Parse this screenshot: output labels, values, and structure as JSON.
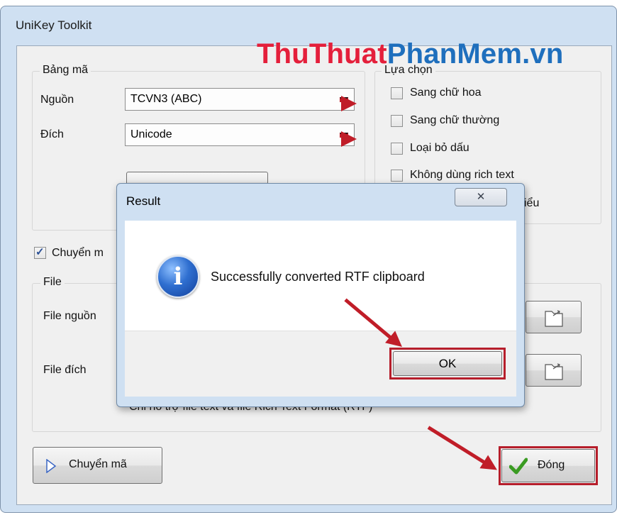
{
  "window": {
    "title": "UniKey Toolkit"
  },
  "watermark": {
    "part1": "ThuThuat",
    "part2": "PhanMem.vn"
  },
  "bang_ma": {
    "legend": "Bảng mã",
    "source_label": "Nguồn",
    "source_value": "TCVN3 (ABC)",
    "dest_label": "Đích",
    "dest_value": "Unicode"
  },
  "options": {
    "legend": "Lựa chọn",
    "items": [
      {
        "label": "Sang chữ hoa",
        "checked": false
      },
      {
        "label": "Sang chữ thường",
        "checked": false
      },
      {
        "label": "Loại bỏ dấu",
        "checked": false
      },
      {
        "label": "Không dùng rich text",
        "checked": false
      },
      {
        "label": "iểu",
        "checked": false
      }
    ]
  },
  "clipboard_checkbox": {
    "label": "Chuyển m",
    "checked": true
  },
  "file": {
    "legend": "File",
    "source_label": "File nguồn",
    "dest_label": "File đích",
    "note": "Chỉ hỗ trợ file text và file Rich Text Format (RTF)"
  },
  "buttons": {
    "convert": "Chuyển mã",
    "close": "Đóng"
  },
  "dialog": {
    "title": "Result",
    "message": "Successfully converted RTF clipboard",
    "ok": "OK",
    "close_glyph": "✕"
  },
  "colors": {
    "highlight": "#b61e2b",
    "watermark_red": "#e41f3b",
    "watermark_blue": "#1f6fbd"
  }
}
